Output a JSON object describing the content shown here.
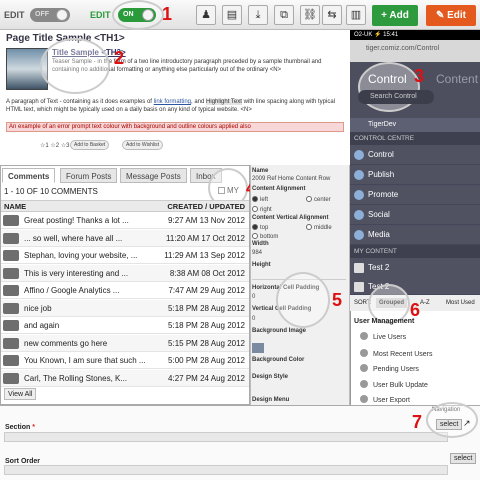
{
  "toolbar": {
    "edit_label_1": "EDIT",
    "toggle_off": "OFF",
    "edit_label_2": "EDIT",
    "toggle_on": "ON",
    "add_label": "+ Add",
    "edit_label": "✎ Edit",
    "icons": [
      "user-icon",
      "document-icon",
      "download-icon",
      "copy-icon",
      "link-icon",
      "swap-icon",
      "columns-icon"
    ]
  },
  "callouts": [
    "1",
    "2",
    "3",
    "4",
    "5",
    "6",
    "7"
  ],
  "preview": {
    "heading": "Page   Title   Sample   <TH1>",
    "sample_title": "Title Sample <TH3>",
    "teaser": "Teaser Sample - in the form of a two line introductory paragraph preceded by a sample thumbnail and containing no additional formatting or anything else particularly out of the ordinary <N>",
    "para_a": "A paragraph of Text - containing as it does examples of ",
    "para_link": "link formatting",
    "para_b": ", and ",
    "para_highlight": "Highlight Text",
    "para_c": " with line spacing along with typical HTML text, which might be typically used on a daily basis on any kind of typical website. <N>",
    "error_text": "An example of an error prompt text colour with background and outline colours applied also",
    "stars": "☆1 ☆2 ☆3 ☆4 ☆5",
    "basket_btn": "Add to Basket",
    "wishlist_btn": "Add to Wishlist"
  },
  "phone": {
    "status": "O2-UK  ⚡ 15:41",
    "url": "tiger.comiz.com/Control",
    "tab_control": "Control",
    "tab_content": "Content",
    "search_placeholder": "Search Control",
    "tigerdev": "TigerDev",
    "control_centre": "CONTROL CENTRE",
    "menu": [
      "Control",
      "Publish",
      "Promote",
      "Social",
      "Media"
    ],
    "my_content": "MY CONTENT",
    "my_items": [
      "Test 2",
      "Test 2"
    ],
    "sort_label": "SORT:",
    "sort_value": "Grouped",
    "sort_az": "A-Z",
    "sort_most": "Most Used",
    "user_mgmt": "User Management",
    "users": [
      "Live Users",
      "Most Recent Users",
      "Pending Users",
      "User Bulk Update",
      "User Export"
    ]
  },
  "comments": {
    "tabs": [
      "Comments",
      "Forum Posts",
      "Message Posts",
      "Inbox"
    ],
    "count": "1 - 10 OF 10 COMMENTS",
    "my_label": "MY",
    "col_name": "NAME",
    "col_date": "CREATED / UPDATED",
    "rows": [
      {
        "name": "Great posting! Thanks a lot ...",
        "date": "9:27 AM 13 Nov 2012"
      },
      {
        "name": "... so well, where have all ...",
        "date": "11:20 AM 17 Oct 2012"
      },
      {
        "name": "Stephan, loving your website, ...",
        "date": "11:29 AM 13 Sep 2012"
      },
      {
        "name": "This is very interesting and ...",
        "date": "8:38 AM 08 Oct 2012"
      },
      {
        "name": "Affino / Google Analytics ...",
        "date": "7:47 AM 29 Aug 2012"
      },
      {
        "name": "nice job",
        "date": "5:18 PM 28 Aug 2012"
      },
      {
        "name": "and again",
        "date": "5:18 PM 28 Aug 2012"
      },
      {
        "name": "new comments go here",
        "date": "5:15 PM 28 Aug 2012"
      },
      {
        "name": "You Known, I am sure that such ...",
        "date": "5:00 PM 28 Aug 2012"
      },
      {
        "name": "Carl, The Rolling Stones, K...",
        "date": "4:27 PM 24 Aug 2012"
      }
    ],
    "view_all": "View All"
  },
  "props": {
    "name_label": "Name",
    "name_value": "2009 Ref Home Content Row",
    "align_label": "Content Alignment",
    "align_left": "left",
    "align_center": "center",
    "align_right": "right",
    "valign_label": "Content Vertical Alignment",
    "valign_top": "top",
    "valign_middle": "middle",
    "valign_bottom": "bottom",
    "width_label": "Width",
    "width_value": "984",
    "height_label": "Height",
    "hpad_label": "Horizontal Cell Padding",
    "hpad_value": "0",
    "vpad_label": "Vertical Cell Padding",
    "vpad_value": "0",
    "bgimg_label": "Background Image",
    "bgcolor_label": "Background Color",
    "design_style": "Design Style",
    "design_menu": "Design Menu"
  },
  "bottom": {
    "section_label": "Section",
    "required": "*",
    "navigation": "Navigation",
    "select": "select",
    "sort_order": "Sort Order"
  },
  "colors": {
    "accent_green": "#2e9a3e",
    "accent_orange": "#e45a1e",
    "callout_red": "#d11",
    "menu_bg": "#505262"
  }
}
